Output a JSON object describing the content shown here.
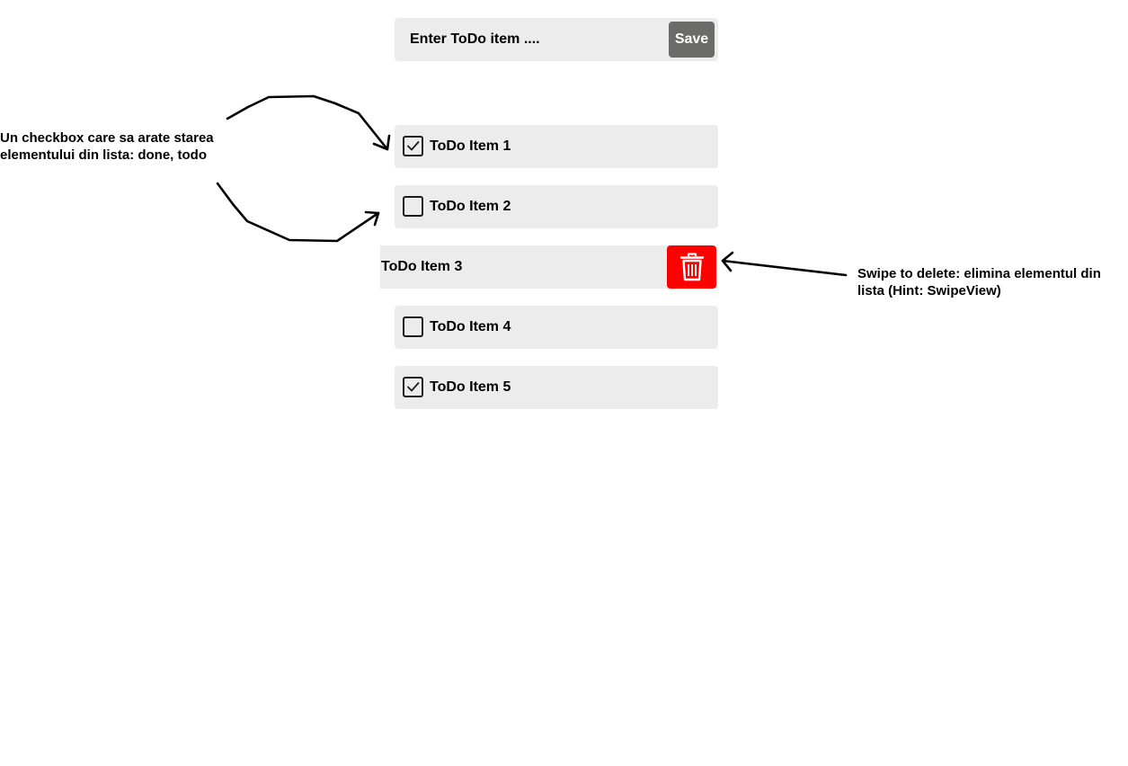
{
  "input_bar": {
    "placeholder": "Enter ToDo item ....",
    "save_label": "Save",
    "save_color": "#6b6b69"
  },
  "todo_items": [
    {
      "label": "ToDo Item 1",
      "done": true
    },
    {
      "label": "ToDo Item 2",
      "done": false
    },
    {
      "label": "ToDo Item 3",
      "swiped": true
    },
    {
      "label": "ToDo Item 4",
      "done": false
    },
    {
      "label": "ToDo Item 5",
      "done": true
    }
  ],
  "delete_action": {
    "icon": "trash-icon",
    "color": "#ff0000"
  },
  "annotations": {
    "checkbox_note": "Un checkbox care sa arate starea\nelementului din lista: done, todo",
    "swipe_note": "Swipe to delete: elimina elementul din\nlista (Hint: SwipeView)"
  },
  "colors": {
    "item_background": "#ececec",
    "text": "#000000"
  }
}
